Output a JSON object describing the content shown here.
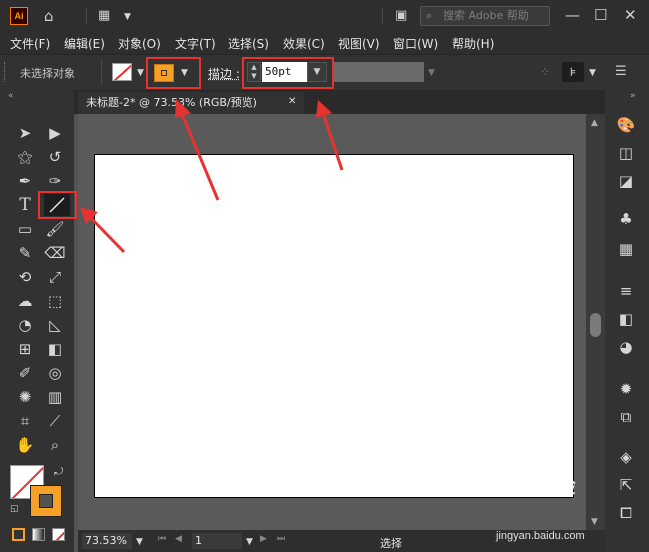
{
  "app": {
    "logo": "Ai"
  },
  "search": {
    "placeholder": "搜索 Adobe 帮助"
  },
  "menu": [
    "文件(F)",
    "编辑(E)",
    "对象(O)",
    "文字(T)",
    "选择(S)",
    "效果(C)",
    "视图(V)",
    "窗口(W)",
    "帮助(H)"
  ],
  "control": {
    "selection_status": "未选择对象",
    "fill_color": "#ffffff",
    "stroke_color": "#f7a027",
    "stroke_label": "描边 :",
    "stroke_weight": "50pt"
  },
  "document": {
    "tab_title": "未标题-2* @ 73.53% (RGB/预览)",
    "close": "✕"
  },
  "status": {
    "zoom": "73.53%",
    "artboard": "1",
    "tool": "选择"
  },
  "window_controls": {
    "minimize": "—",
    "maximize": "☐",
    "close": "✕"
  },
  "colors": {
    "accent": "#f7a027",
    "annotation": "#e8322f"
  },
  "watermark": {
    "text": "Baidu经验",
    "url": "jingyan.baidu.com"
  }
}
